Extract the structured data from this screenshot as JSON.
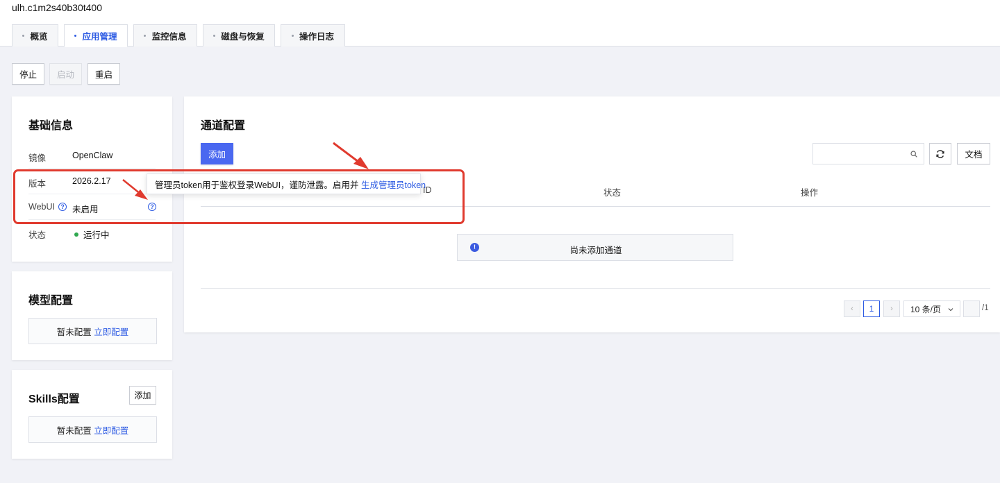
{
  "instance_name": "ulh.c1m2s40b30t400",
  "tabs": [
    {
      "label": "概览",
      "active": false
    },
    {
      "label": "应用管理",
      "active": true
    },
    {
      "label": "监控信息",
      "active": false
    },
    {
      "label": "磁盘与恢复",
      "active": false
    },
    {
      "label": "操作日志",
      "active": false
    }
  ],
  "actions": {
    "stop": "停止",
    "start": "启动",
    "restart": "重启"
  },
  "basic_info": {
    "title": "基础信息",
    "rows": [
      {
        "label": "镜像",
        "value": "OpenClaw"
      },
      {
        "label": "版本",
        "value": "2026.2.17"
      },
      {
        "label": "WebUI",
        "value": "未启用"
      },
      {
        "label": "状态",
        "value": "运行中"
      }
    ]
  },
  "tooltip": {
    "text": "管理员token用于鉴权登录WebUI，谨防泄露。启用并",
    "link": "生成管理员token"
  },
  "model_config": {
    "title": "模型配置",
    "empty_text": "暂未配置",
    "link": "立即配置"
  },
  "skills_config": {
    "title": "Skills配置",
    "add_label": "添加",
    "empty_text": "暂未配置",
    "link": "立即配置"
  },
  "channel_config": {
    "title": "通道配置",
    "add_label": "添加",
    "search_placeholder": "",
    "docs_label": "文档",
    "columns": [
      "ID",
      "状态",
      "操作"
    ],
    "empty_text": "尚未添加通道",
    "pagination": {
      "current_page": "1",
      "page_size": "10 条/页",
      "total_pages": "/1"
    }
  },
  "colors": {
    "accent": "#2d5be3",
    "primary_button": "#4a68f0",
    "annotation_red": "#e03a2e",
    "status_running": "#2fa84f"
  }
}
